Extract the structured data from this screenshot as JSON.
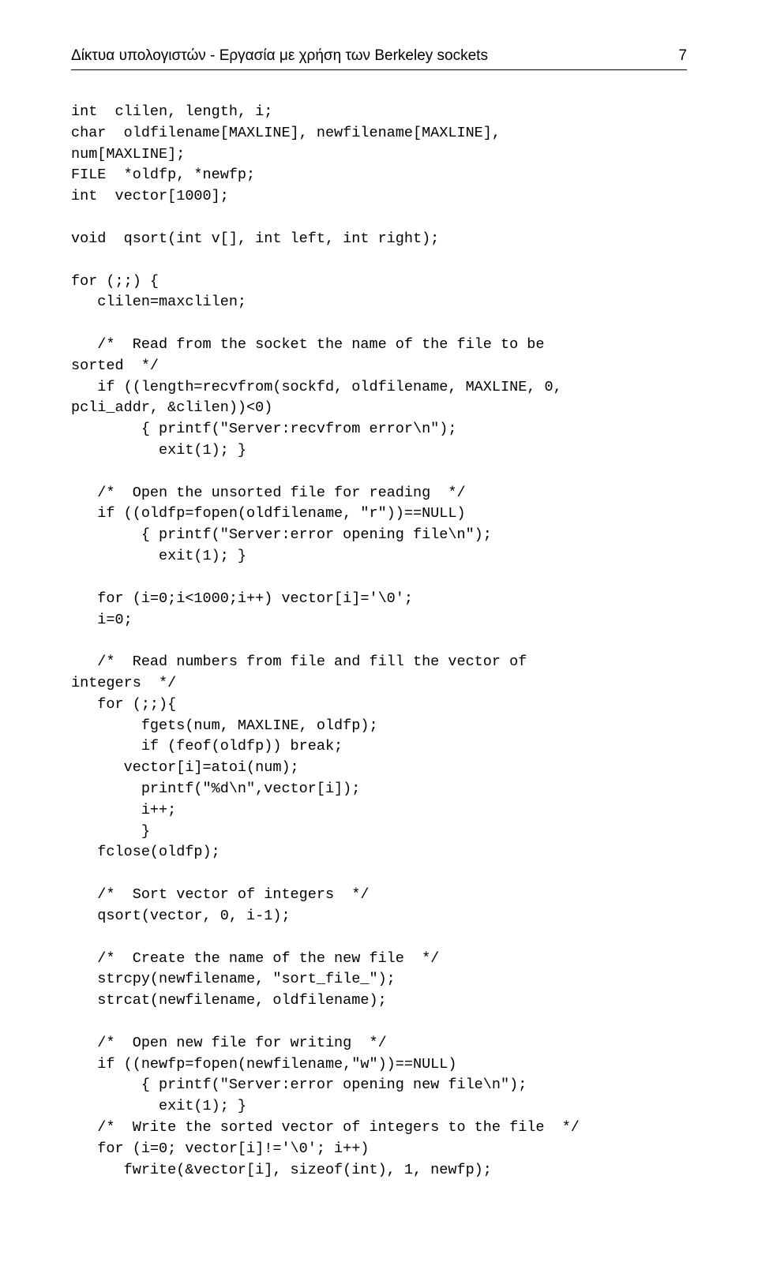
{
  "header": {
    "title": "Δίκτυα υπολογιστών - Εργασία με χρήση των Berkeley sockets",
    "page": "7"
  },
  "code": "int  clilen, length, i;\nchar  oldfilename[MAXLINE], newfilename[MAXLINE],\nnum[MAXLINE];\nFILE  *oldfp, *newfp;\nint  vector[1000];\n\nvoid  qsort(int v[], int left, int right);\n\nfor (;;) {\n   clilen=maxclilen;\n\n   /*  Read from the socket the name of the file to be\nsorted  */\n   if ((length=recvfrom(sockfd, oldfilename, MAXLINE, 0,\npcli_addr, &clilen))<0)\n        { printf(\"Server:recvfrom error\\n\");\n          exit(1); }\n\n   /*  Open the unsorted file for reading  */\n   if ((oldfp=fopen(oldfilename, \"r\"))==NULL)\n        { printf(\"Server:error opening file\\n\");\n          exit(1); }\n\n   for (i=0;i<1000;i++) vector[i]='\\0';\n   i=0;\n\n   /*  Read numbers from file and fill the vector of\nintegers  */\n   for (;;){\n        fgets(num, MAXLINE, oldfp);\n        if (feof(oldfp)) break;\n      vector[i]=atoi(num);\n        printf(\"%d\\n\",vector[i]);\n        i++;\n        }\n   fclose(oldfp);\n\n   /*  Sort vector of integers  */\n   qsort(vector, 0, i-1);\n\n   /*  Create the name of the new file  */\n   strcpy(newfilename, \"sort_file_\");\n   strcat(newfilename, oldfilename);\n\n   /*  Open new file for writing  */\n   if ((newfp=fopen(newfilename,\"w\"))==NULL)\n        { printf(\"Server:error opening new file\\n\");\n          exit(1); }\n   /*  Write the sorted vector of integers to the file  */\n   for (i=0; vector[i]!='\\0'; i++)\n      fwrite(&vector[i], sizeof(int), 1, newfp);"
}
